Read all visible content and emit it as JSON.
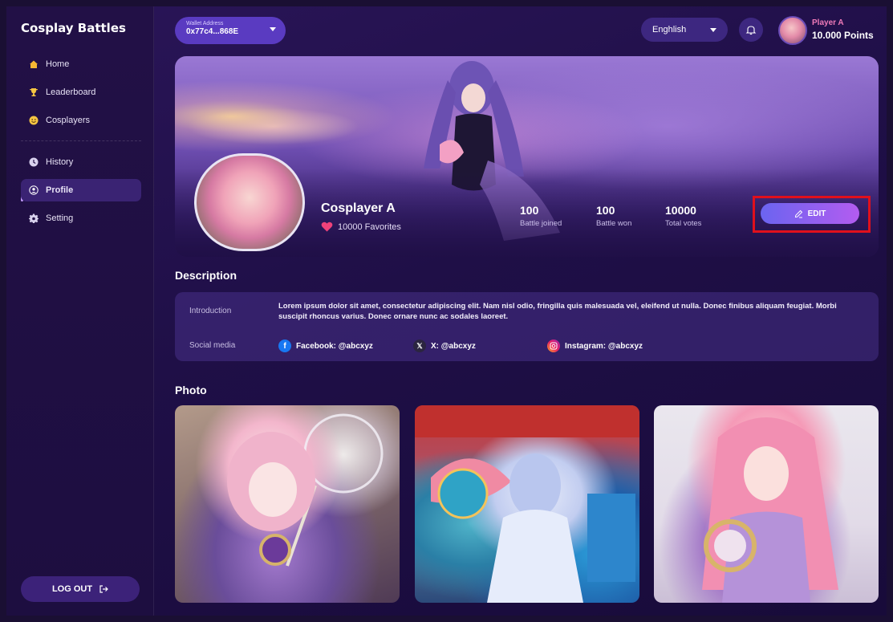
{
  "app": {
    "title": "Cosplay Battles"
  },
  "sidebar": {
    "items": [
      {
        "label": "Home",
        "icon": "home-icon"
      },
      {
        "label": "Leaderboard",
        "icon": "trophy-icon"
      },
      {
        "label": "Cosplayers",
        "icon": "smiley-icon"
      },
      {
        "label": "History",
        "icon": "clock-icon"
      },
      {
        "label": "Profile",
        "icon": "profile-icon",
        "active": true
      },
      {
        "label": "Setting",
        "icon": "gear-icon"
      }
    ],
    "logout_label": "LOG OUT"
  },
  "header": {
    "wallet_label": "Wallet Address",
    "wallet_address": "0x77c4...868E",
    "language": "Enghlish",
    "user_name": "Player A",
    "user_points": "10.000 Points"
  },
  "profile": {
    "name": "Cosplayer A",
    "favorites": "10000 Favorites",
    "stats": [
      {
        "value": "100",
        "label": "Battle joined"
      },
      {
        "value": "100",
        "label": "Battle won"
      },
      {
        "value": "10000",
        "label": "Total votes"
      }
    ],
    "edit_label": "EDIT"
  },
  "description": {
    "title": "Description",
    "intro_label": "Introduction",
    "intro_text": "Lorem ipsum dolor sit amet, consectetur adipiscing elit. Nam nisl odio, fringilla quis malesuada vel, eleifend ut nulla. Donec finibus aliquam feugiat. Morbi suscipit rhoncus varius. Donec ornare nunc ac sodales laoreet.",
    "social_label": "Social media",
    "facebook": "Facebook: @abcxyz",
    "x": "X: @abcxyz",
    "instagram": "Instagram: @abcxyz"
  },
  "photos": {
    "title": "Photo"
  },
  "colors": {
    "accent": "#5a3bc1",
    "highlight": "#e0101c",
    "pink": "#f07ab9"
  }
}
